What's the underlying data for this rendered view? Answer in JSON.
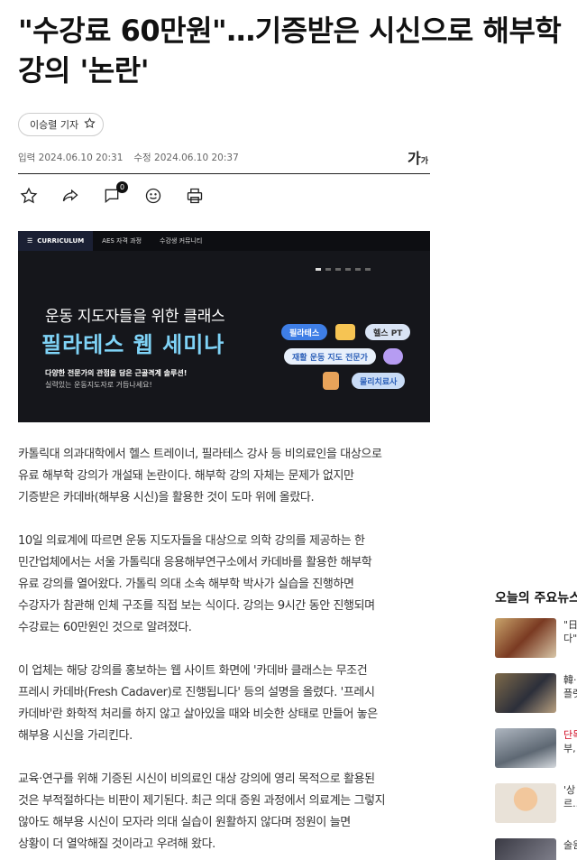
{
  "article": {
    "headline": "\"수강료 60만원\"…기증받은 시신으로 해부학 강의 '논란'",
    "reporter": "이승렬 기자",
    "published": "입력 2024.06.10 20:31",
    "modified": "수정 2024.06.10 20:37",
    "font_size_label": "가",
    "font_size_small": "가",
    "comment_count": "0",
    "paragraphs": [
      [
        "카톨릭대 의과대학에서 헬스 트레이너, 필라테스 강사 등 비의료인을 대상으로",
        "유료 해부학 강의가 개설돼 논란이다. 해부학 강의 자체는 문제가 없지만",
        "기증받은 카데바(해부용 시신)을 활용한 것이 도마 위에 올랐다."
      ],
      [
        "10일 의료계에 따르면 운동 지도자들을 대상으로 의학 강의를 제공하는 한",
        "민간업체에서는 서울 가톨릭대 응용해부연구소에서 카데바를 활용한 해부학",
        "유료 강의를 열어왔다. 가톨릭 의대 소속 해부학 박사가 실습을 진행하면",
        "수강자가 참관해 인체 구조를 직접 보는 식이다. 강의는 9시간 동안 진행되며",
        "수강료는 60만원인 것으로 알려졌다."
      ],
      [
        "이 업체는 해당 강의를 홍보하는 웹 사이트 화면에 '카데바 클래스는 무조건",
        "프레시 카데바(Fresh Cadaver)로 진행됩니다' 등의 설명을 올렸다. '프레시",
        "카데바'란 화학적 처리를 하지 않고 살아있을 때와 비슷한 상태로 만들어 놓은",
        "해부용 시신을 가리킨다."
      ],
      [
        "교육·연구를 위해 기증된 시신이 비의료인 대상 강의에 영리 목적으로 활용된",
        "것은 부적절하다는 비판이 제기된다. 최근 의대 증원 과정에서 의료계는 그렇지",
        "않아도 해부용 시신이 모자라 의대 실습이 원활하지 않다며 정원이 늘면",
        "상황이 더 열악해질 것이라고 우려해 왔다."
      ]
    ]
  },
  "banner": {
    "nav_current": "CURRICULUM",
    "nav_tabs": [
      "AES 자격 과정",
      "수강생 커뮤니티"
    ],
    "title": "운동 지도자들을 위한 클래스",
    "big_title": "필라테스 웹 세미나",
    "sub1": "다양한 전문가의 관점을 담은 근골격계 솔루션!",
    "sub2": "실력있는 운동지도자로 거듭나세요!",
    "pills": [
      "필라테스",
      "헬스 PT",
      "재활 운동 지도 전문가",
      "물리치료사"
    ]
  },
  "sidebar": {
    "title": "오늘의 주요뉴스",
    "items": [
      {
        "text1": "\"日",
        "text2": "다\"",
        "red": false
      },
      {
        "text1": "韓·",
        "text2": "플랫",
        "red": false
      },
      {
        "text1": "단독",
        "text2": "부, 사",
        "red": true
      },
      {
        "text1": "'상",
        "text2": "르...",
        "red": false
      },
      {
        "text1": "술원",
        "text2": "",
        "red": false
      }
    ]
  },
  "icons": [
    "star-icon",
    "share-icon",
    "comment-icon",
    "emoji-icon",
    "print-icon"
  ]
}
